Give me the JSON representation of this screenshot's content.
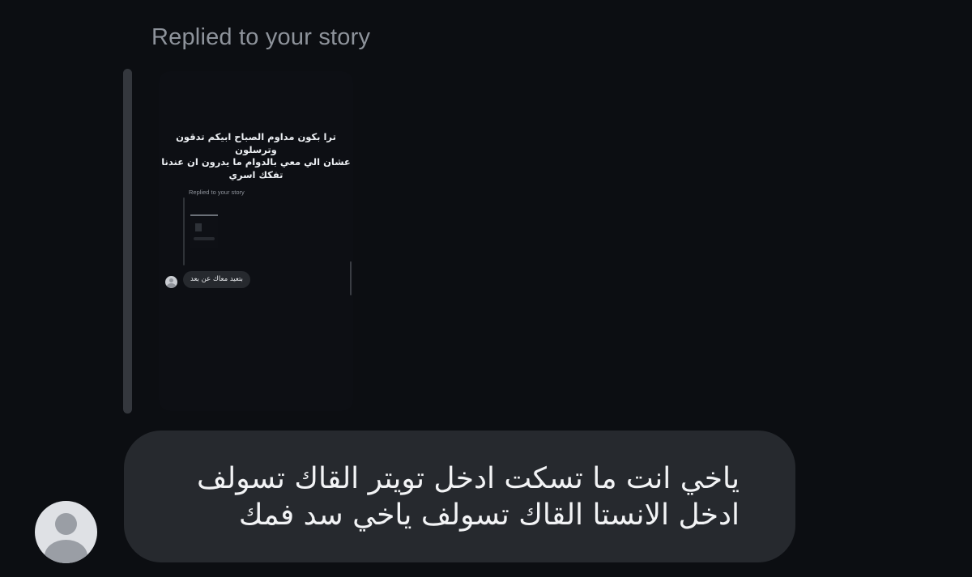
{
  "reply_header": "Replied to your story",
  "story": {
    "caption_lines": [
      "ترا بكون مداوم الصباح ابيكم تدقون وترسلون",
      "عشان الي معي بالدوام ما يدرون ان عندنا",
      "تفكك اسري"
    ],
    "nested_reply_header": "Replied to your story",
    "nested_reply_message": "بتعيد معاك عن بعد"
  },
  "message": {
    "lines": [
      "ياخي انت ما تسكت ادخل تويتر القاك تسولف",
      "ادخل الانستا القاك تسولف ياخي سد فمك"
    ]
  },
  "colors": {
    "background": "#0c0e12",
    "bubble": "#26292e",
    "header_text": "#8e939b",
    "message_text": "#f2f3f5"
  },
  "icons": {
    "sender_avatar": "default-avatar-icon"
  }
}
